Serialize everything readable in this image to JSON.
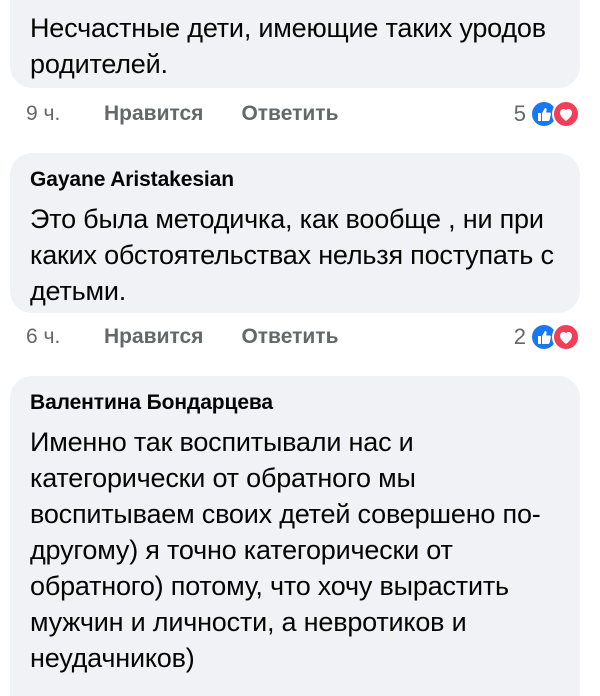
{
  "comments": [
    {
      "author": "",
      "text": "Несчастные дети, имеющие таких уродов родителей.",
      "time": "9 ч.",
      "like_label": "Нравится",
      "reply_label": "Ответить",
      "reaction_count": "5"
    },
    {
      "author": "Gayane Aristakesian",
      "text": "Это была методичка, как вообще , ни при каких обстоятельствах нельзя поступать с детьми.",
      "time": "6 ч.",
      "like_label": "Нравится",
      "reply_label": "Ответить",
      "reaction_count": "2"
    },
    {
      "author": "Валентина Бондарцева",
      "text": "Именно так воспитывали нас и категорически от обратного мы воспитываем своих детей совершено по-другому) я точно категорически от обратного) потому, что хочу вырастить мужчин и личности, а невротиков и неудачников)"
    }
  ],
  "reaction_icons": [
    "like-icon",
    "love-icon"
  ],
  "colors": {
    "like_blue": "#1877f2",
    "love_red": "#f33e58",
    "bubble_bg": "#f0f2f5",
    "meta_gray": "#65676b"
  }
}
